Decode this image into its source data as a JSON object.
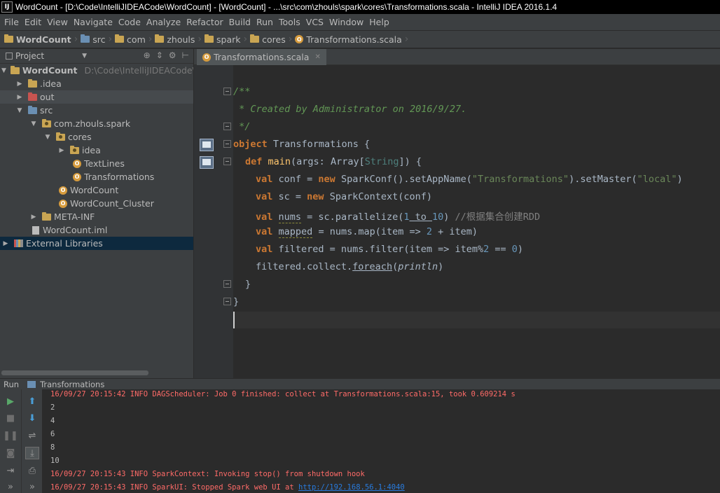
{
  "window": {
    "title": "WordCount - [D:\\Code\\IntelliJIDEACode\\WordCount] - [WordCount] - ...\\src\\com\\zhouls\\spark\\cores\\Transformations.scala - IntelliJ IDEA 2016.1.4",
    "app_icon": "IJ"
  },
  "menu": [
    "File",
    "Edit",
    "View",
    "Navigate",
    "Code",
    "Analyze",
    "Refactor",
    "Build",
    "Run",
    "Tools",
    "VCS",
    "Window",
    "Help"
  ],
  "breadcrumbs": [
    "WordCount",
    "src",
    "com",
    "zhouls",
    "spark",
    "cores",
    "Transformations.scala"
  ],
  "project_panel": {
    "title": "Project"
  },
  "tree": [
    {
      "label": "WordCount",
      "path": "D:\\Code\\IntelliJIDEACode\\WordCount"
    },
    {
      "label": ".idea"
    },
    {
      "label": "out"
    },
    {
      "label": "src"
    },
    {
      "label": "com.zhouls.spark"
    },
    {
      "label": "cores"
    },
    {
      "label": "idea"
    },
    {
      "label": "TextLines"
    },
    {
      "label": "Transformations"
    },
    {
      "label": "WordCount"
    },
    {
      "label": "WordCount_Cluster"
    },
    {
      "label": "META-INF"
    },
    {
      "label": "WordCount.iml"
    },
    {
      "label": "External Libraries"
    }
  ],
  "editor": {
    "tab": "Transformations.scala",
    "code": {
      "l1": "/**",
      "l2": " * Created by Administrator on 2016/9/27.",
      "l3": " */",
      "object_kw": "object",
      "object_name": " Transformations {",
      "def_kw": "def",
      "main": "main",
      "args": "(args: Array[",
      "string_t": "String",
      "args_end": "]) {",
      "val": "val",
      "new": "new",
      "conf_a": " conf = ",
      "conf_b": " SparkConf().setAppName(",
      "conf_str1": "\"Transformations\"",
      "conf_c": ").setMaster(",
      "conf_str2": "\"local\"",
      "conf_d": ")",
      "sc_a": " sc = ",
      "sc_b": " SparkContext(conf)",
      "nums_name": "nums",
      "nums_a": " = sc.parallelize(",
      "nums_n1": "1",
      "nums_to": " to ",
      "nums_n2": "10",
      "nums_b": ") ",
      "nums_cm": "//根据集合创建RDD",
      "mapped_name": "mapped",
      "mapped_a": " = nums.map(item => ",
      "mapped_n": "2",
      "mapped_b": " + item)",
      "filt_a": " filtered = nums.filter(item => item%",
      "filt_n1": "2",
      "filt_b": " == ",
      "filt_n2": "0",
      "filt_c": ")",
      "coll_a": "filtered.collect.",
      "coll_fe": "foreach",
      "coll_b": "(",
      "coll_p": "println",
      "coll_c": ")",
      "close1": "}",
      "close2": "}"
    }
  },
  "run_panel": {
    "label": "Run",
    "tab": "Transformations",
    "lines": [
      "16/09/27 20:15:42 INFO DAGScheduler: Job 0 finished: collect at Transformations.scala:15, took 0.609214 s",
      "2",
      "4",
      "6",
      "8",
      "10",
      "16/09/27 20:15:43 INFO SparkContext: Invoking stop() from shutdown hook",
      "16/09/27 20:15:43 INFO SparkUI: Stopped Spark web UI at "
    ],
    "link": "http://192.168.56.1:4040"
  },
  "colors": {
    "background": "#2b2b2b",
    "panel": "#3c3f41",
    "keyword": "#cc7832",
    "string": "#6a8759",
    "number": "#6897bb",
    "comment": "#629755",
    "function": "#ffc66d",
    "error_text": "#ff6b68"
  }
}
